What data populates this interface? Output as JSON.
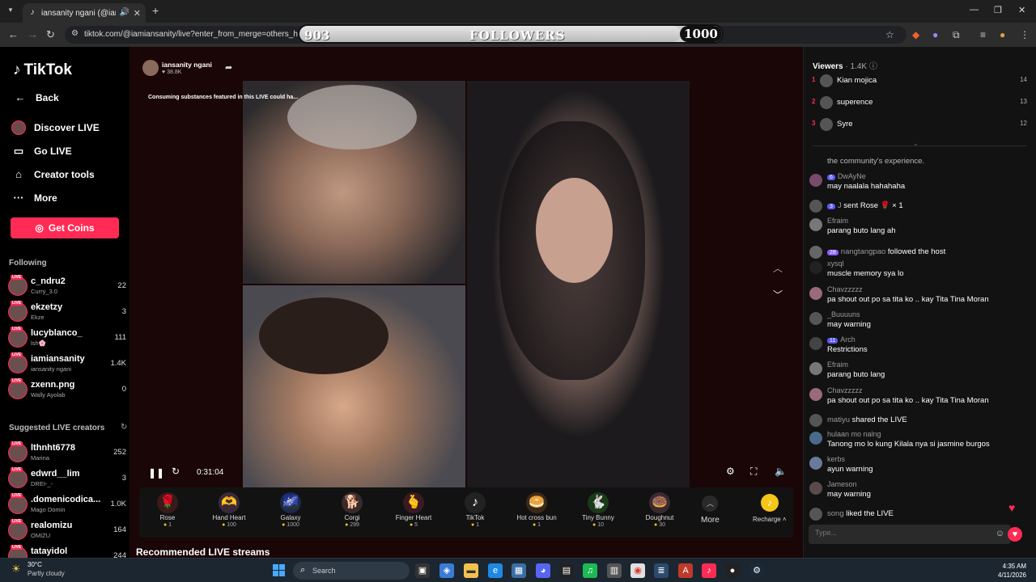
{
  "browser": {
    "tab_title": "iansanity ngani (@iamiansa...",
    "url": "tiktok.com/@iamiansanity/live?enter_from_merge=others_home"
  },
  "followers_overlay": {
    "current": "903",
    "label": "FOLLOWERS",
    "goal": "1000",
    "progress": 0.903
  },
  "sidebar": {
    "logo": "TikTok",
    "back": "Back",
    "nav": [
      {
        "label": "Discover LIVE",
        "icon": "discover-live-icon"
      },
      {
        "label": "Go LIVE",
        "icon": "go-live-icon"
      },
      {
        "label": "Creator tools",
        "icon": "creator-tools-icon"
      },
      {
        "label": "More",
        "icon": "more-icon"
      }
    ],
    "get_coins": "Get Coins",
    "following_title": "Following",
    "following": [
      {
        "name": "c_ndru2",
        "sub": "Curry_3.0",
        "count": "22"
      },
      {
        "name": "ekzetzy",
        "sub": "Ekze",
        "count": "3"
      },
      {
        "name": "lucyblanco_",
        "sub": "lsh🌸",
        "count": "111"
      },
      {
        "name": "iamiansanity",
        "sub": "iansanity ngani",
        "count": "1.4K"
      },
      {
        "name": "zxenn.png",
        "sub": "Wally Ayolab",
        "count": "0"
      }
    ],
    "suggested_title": "Suggested LIVE creators",
    "suggested": [
      {
        "name": "lthnht6778",
        "sub": "Marina",
        "count": "252"
      },
      {
        "name": "edwrd__lim",
        "sub": "DREI-_-",
        "count": "3"
      },
      {
        "name": ".domenicodica...",
        "sub": "Mago Domin",
        "count": "1.0K"
      },
      {
        "name": "realomizu",
        "sub": "OMIZU",
        "count": "164"
      },
      {
        "name": "tatayidol",
        "sub": "",
        "count": "244"
      }
    ]
  },
  "stream": {
    "host_name": "iansanity ngani",
    "host_likes": "♥ 38.8K",
    "warning": "Consuming substances featured in this LIVE could ha...",
    "timer": "0:31:04",
    "gifts": [
      {
        "name": "Rose",
        "price": "1",
        "icon": "rose-icon",
        "glyph": "🌹"
      },
      {
        "name": "Hand Heart",
        "price": "100",
        "icon": "hand-heart-icon",
        "glyph": "🫶"
      },
      {
        "name": "Galaxy",
        "price": "1000",
        "icon": "galaxy-icon",
        "glyph": "🌌"
      },
      {
        "name": "Corgi",
        "price": "299",
        "icon": "corgi-icon",
        "glyph": "🐕"
      },
      {
        "name": "Finger Heart",
        "price": "5",
        "icon": "finger-heart-icon",
        "glyph": "🫰"
      },
      {
        "name": "TikTok",
        "price": "1",
        "icon": "tiktok-gift-icon",
        "glyph": "♪"
      },
      {
        "name": "Hot cross bun",
        "price": "1",
        "icon": "hot-cross-bun-icon",
        "glyph": "🥯"
      },
      {
        "name": "Tiny Bunny",
        "price": "10",
        "icon": "tiny-bunny-icon",
        "glyph": "🐇"
      },
      {
        "name": "Doughnut",
        "price": "30",
        "icon": "doughnut-icon",
        "glyph": "🍩"
      }
    ],
    "more": "More",
    "recharge": "Recharge",
    "recommended_title": "Recommended LIVE streams"
  },
  "chat": {
    "viewers_label": "Viewers",
    "viewers_count": "· 1.4K",
    "top_viewers": [
      {
        "rank": "1",
        "name": "Kian mojica",
        "score": "14"
      },
      {
        "rank": "2",
        "name": "superence",
        "score": "13"
      },
      {
        "rank": "3",
        "name": "Syre",
        "score": "12"
      }
    ],
    "community_text": "the community's experience.",
    "messages": [
      {
        "user": "DwAyNe",
        "badge": "6",
        "text": "may naalala hahahaha",
        "type": "two"
      },
      {
        "user": "J",
        "badge": "3",
        "text": "sent Rose 🌹 × 1",
        "type": "one-gift"
      },
      {
        "user": "Efraim",
        "text": "parang buto lang ah",
        "type": "two"
      },
      {
        "user": "nangtangpao",
        "badge": "28",
        "text": "followed the host",
        "type": "one-follow"
      },
      {
        "user": "xysql",
        "text": "muscle memory sya lo",
        "type": "two"
      },
      {
        "user": "Chavzzzzz",
        "text": "pa shout out po sa tita ko .. kay Tita Tina Moran",
        "type": "two"
      },
      {
        "user": "_Buuuuns",
        "text": "may warning",
        "type": "two"
      },
      {
        "user": "Arch",
        "badge": "11",
        "text": "Restrictions",
        "type": "two"
      },
      {
        "user": "Efraim",
        "text": "parang buto lang",
        "type": "two"
      },
      {
        "user": "Chavzzzzz",
        "text": "pa shout out po sa tita ko .. kay Tita Tina Moran",
        "type": "two"
      },
      {
        "user": "matiyu",
        "text": "shared the LIVE",
        "type": "one-share"
      },
      {
        "user": "hulaan mo nalng",
        "text": "Tanong mo lo kung Kilala nya si jasmine burgos",
        "type": "two"
      },
      {
        "user": "kerbs",
        "text": "ayun warning",
        "type": "two"
      },
      {
        "user": "Jameson",
        "text": "may warning",
        "type": "two"
      },
      {
        "user": "song",
        "text": "liked the LIVE",
        "type": "one-like"
      }
    ],
    "input_placeholder": "Type..."
  },
  "taskbar": {
    "temp": "30°C",
    "weather": "Partly cloudy",
    "search": "Search",
    "time": "4:35 AM",
    "date": "4/11/2026"
  }
}
